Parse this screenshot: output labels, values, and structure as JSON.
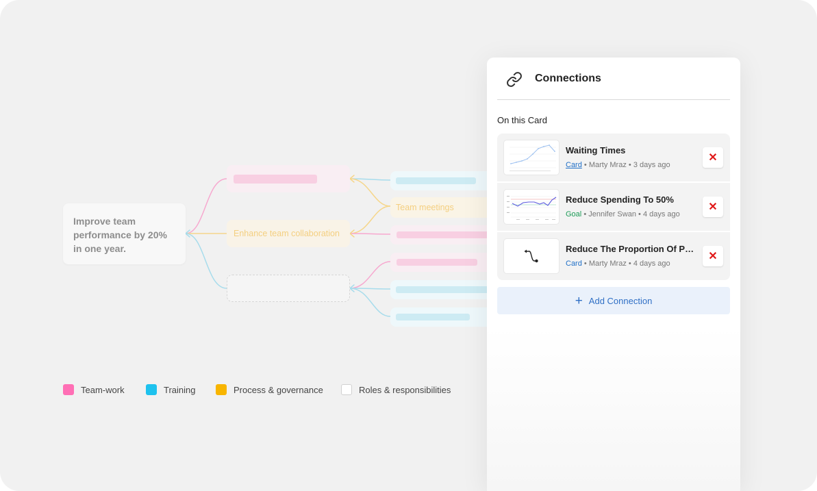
{
  "mindmap": {
    "root_text": "Improve team performance by 20% in one year.",
    "branch_middle_text": "Enhance team collaboration",
    "leaf_text": "Team meetings",
    "colors": {
      "pink": "#f7a8cf",
      "blue": "#a7dcec",
      "yellow": "#f6d68a"
    }
  },
  "legend": [
    {
      "label": "Team-work",
      "color": "#ff6fb5"
    },
    {
      "label": "Training",
      "color": "#1ec2ee"
    },
    {
      "label": "Process & governance",
      "color": "#f8b500"
    },
    {
      "label": "Roles & responsibilities",
      "color": "#ffffff"
    }
  ],
  "panel": {
    "title": "Connections",
    "icon": "link-icon",
    "section_label": "On this Card",
    "separator": "•",
    "connections": [
      {
        "title": "Waiting Times",
        "type": "Card",
        "author": "Marty Mraz",
        "time": "3 days ago",
        "thumbnail": "line-chart-thumbnail"
      },
      {
        "title": "Reduce Spending To 50%",
        "type": "Goal",
        "author": "Jennifer Swan",
        "time": "4 days ago",
        "thumbnail": "trend-chart-thumbnail"
      },
      {
        "title": "Reduce The Proportion Of Poor Quality Calls",
        "type": "Card",
        "author": "Marty Mraz",
        "time": "4 days ago",
        "thumbnail": "connector-arrow-thumbnail"
      }
    ],
    "remove_symbol": "✕",
    "add_button": {
      "icon": "+",
      "label": "Add Connection"
    }
  }
}
